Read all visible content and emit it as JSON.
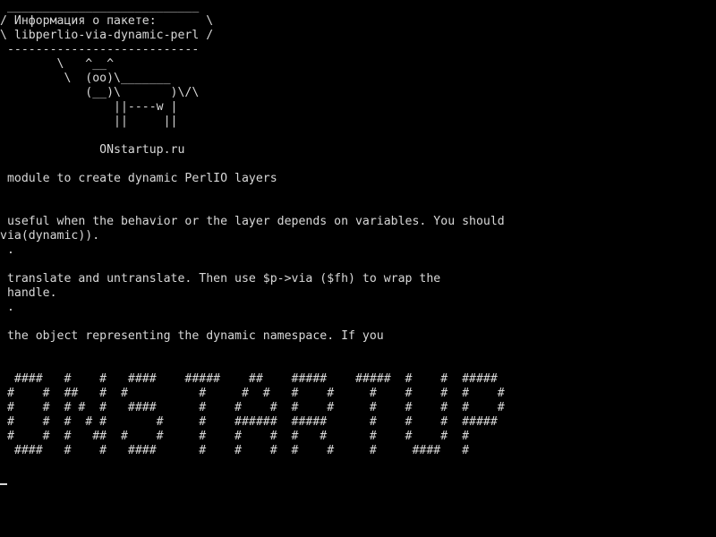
{
  "terminal": {
    "lines": [
      " ___________________________",
      "/ Информация о пакете:       \\",
      "\\ libperlio-via-dynamic-perl /",
      " ---------------------------",
      "        \\   ^__^",
      "         \\  (oo)\\_______",
      "            (__)\\       )\\/\\",
      "                ||----w |",
      "                ||     ||",
      "",
      "              ONstartup.ru",
      "",
      " module to create dynamic PerlIO layers",
      "",
      "",
      " useful when the behavior or the layer depends on variables. You should",
      "via(dynamic)).",
      " .",
      "",
      " translate and untranslate. Then use $p->via ($fh) to wrap the",
      " handle.",
      " .",
      "",
      " the object representing the dynamic namespace. If you",
      "",
      "",
      "  ####   #    #   ####    #####    ##    #####    #####  #    #  #####",
      " #    #  ##   #  #          #     #  #   #    #     #    #    #  #    #",
      " #    #  # #  #   ####      #    #    #  #    #     #    #    #  #    #",
      " #    #  #  # #       #     #    ######  #####      #    #    #  #####",
      " #    #  #   ##  #    #     #    #    #  #   #      #    #    #  #",
      "  ####   #    #   ####      #    #    #  #    #     #     ####   #"
    ]
  }
}
